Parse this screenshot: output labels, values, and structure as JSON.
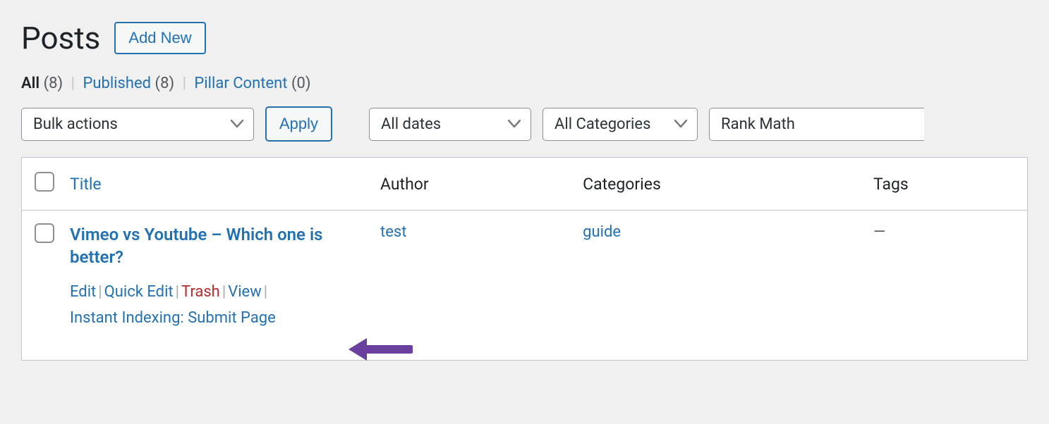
{
  "header": {
    "title": "Posts",
    "add_new": "Add New"
  },
  "subsubsub": {
    "all_label": "All",
    "all_count": "(8)",
    "published_label": "Published",
    "published_count": "(8)",
    "pillar_label": "Pillar Content",
    "pillar_count": "(0)"
  },
  "filters": {
    "bulk_actions": "Bulk actions",
    "apply": "Apply",
    "all_dates": "All dates",
    "all_categories": "All Categories",
    "rank_math": "Rank Math"
  },
  "table": {
    "headers": {
      "title": "Title",
      "author": "Author",
      "categories": "Categories",
      "tags": "Tags"
    },
    "row": {
      "title": "Vimeo vs Youtube – Which one is better?",
      "author": "test",
      "category": "guide",
      "tags": "—",
      "actions": {
        "edit": "Edit",
        "quick_edit": "Quick Edit",
        "trash": "Trash",
        "view": "View",
        "instant_indexing": "Instant Indexing: Submit Page"
      }
    }
  }
}
